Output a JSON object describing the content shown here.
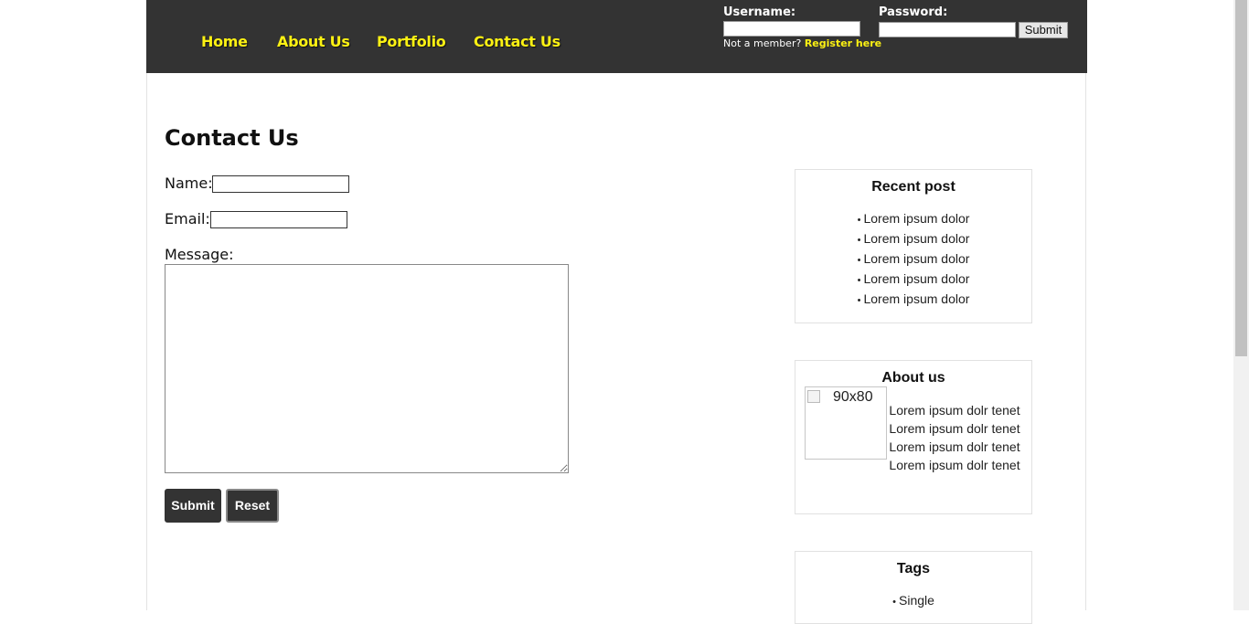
{
  "nav": {
    "items": [
      "Home",
      "About Us",
      "Portfolio",
      "Contact Us"
    ]
  },
  "login": {
    "username_label": "Username:",
    "username_value": "",
    "password_label": "Password:",
    "password_value": "",
    "submit_label": "Submit",
    "not_member_text": "Not a member?",
    "register_link": "Register here"
  },
  "main": {
    "title": "Contact Us",
    "name_label": "Name:",
    "name_value": "",
    "email_label": "Email:",
    "email_value": "",
    "message_label": "Message:",
    "message_value": "",
    "submit_label": "Submit",
    "reset_label": "Reset"
  },
  "sidebar": {
    "recent_post": {
      "title": "Recent post",
      "items": [
        "Lorem ipsum dolor",
        "Lorem ipsum dolor",
        "Lorem ipsum dolor",
        "Lorem ipsum dolor",
        "Lorem ipsum dolor"
      ]
    },
    "about": {
      "title": "About us",
      "image_alt": "90x80",
      "text": "Lorem ipsum dolr tenetLorem ipsum dolr tenetLorem ipsum dolr tenetLorem ipsum dolr tenet"
    },
    "tags": {
      "title": "Tags",
      "items": [
        "Single"
      ]
    }
  },
  "colors": {
    "header_bg": "#333333",
    "nav_link": "#fcf113",
    "button_bg": "#333333"
  }
}
